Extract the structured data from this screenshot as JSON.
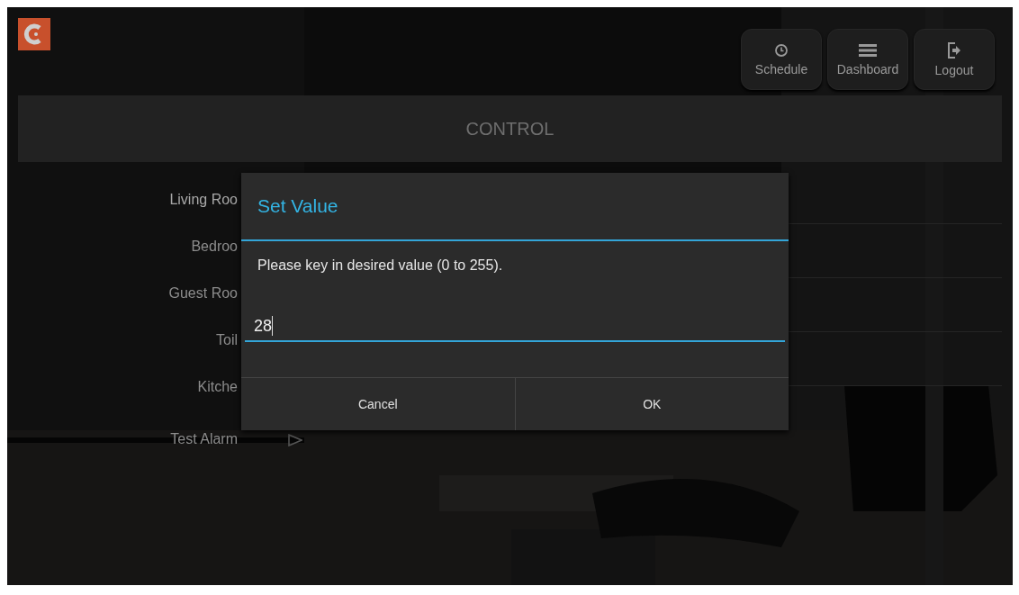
{
  "header": {
    "buttons": [
      {
        "label": "Schedule"
      },
      {
        "label": "Dashboard"
      },
      {
        "label": "Logout"
      }
    ]
  },
  "section_title": "CONTROL",
  "rooms": [
    {
      "label": "Living Roo"
    },
    {
      "label": "Bedroo"
    },
    {
      "label": "Guest Roo"
    },
    {
      "label": "Toil"
    },
    {
      "label": "Kitche"
    },
    {
      "label": "Test Alarm",
      "kind": "play"
    }
  ],
  "dialog": {
    "title": "Set Value",
    "message": "Please key in desired value (0 to 255).",
    "value": "28",
    "buttons": [
      "Cancel",
      "OK"
    ]
  }
}
